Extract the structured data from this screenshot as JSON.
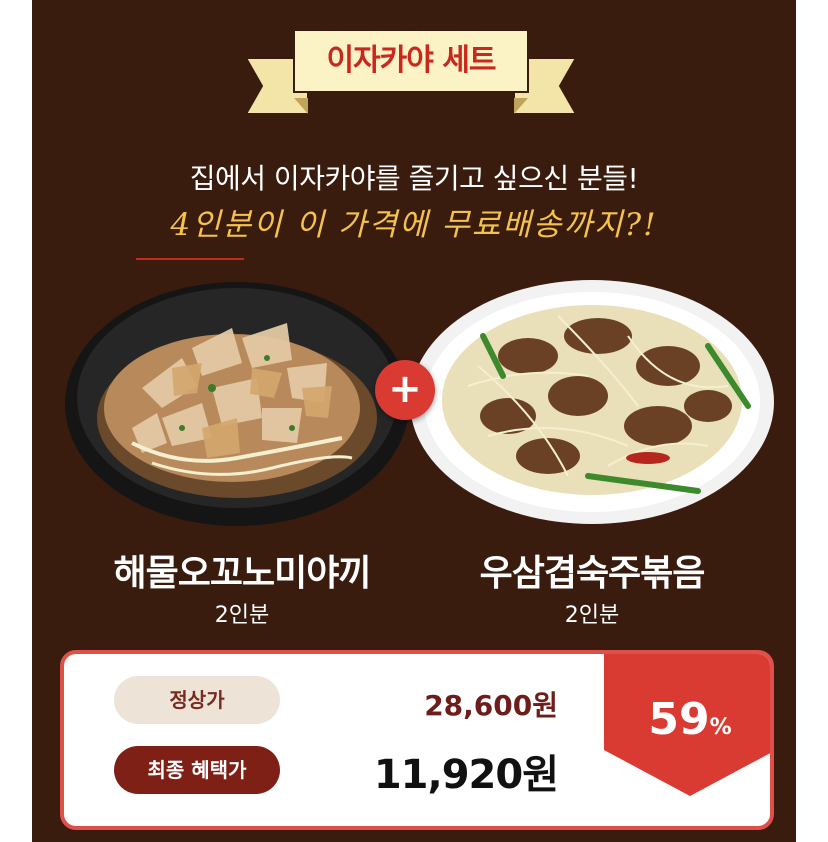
{
  "header": {
    "ribbon_title": "이자카야 세트"
  },
  "intro": {
    "subtitle": "집에서 이자카야를 즐기고 싶으신 분들!",
    "highlight": "4인분이 이 가격에 무료배송까지?!"
  },
  "plus_symbol": "+",
  "dishes": [
    {
      "name": "해물오꼬노미야끼",
      "portion": "2인분",
      "icon": "okonomiyaki-image"
    },
    {
      "name": "우삼겹숙주볶음",
      "portion": "2인분",
      "icon": "beef-bean-sprout-image"
    }
  ],
  "pricing": {
    "regular_label": "정상가",
    "regular_price": "28,600원",
    "final_label": "최종 혜택가",
    "final_price": "11,920원",
    "discount_value": "59",
    "discount_unit": "%"
  },
  "colors": {
    "background": "#3a1c0f",
    "ribbon": "#fbf2c6",
    "accent_red": "#d93a31",
    "highlight_yellow": "#f5c34d"
  }
}
